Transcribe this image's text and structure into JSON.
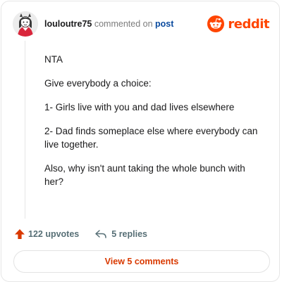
{
  "comment": {
    "username": "louloutre75",
    "commented_text": "commented on",
    "post_link": "post",
    "body": [
      "NTA",
      "Give everybody a choice:",
      "1- Girls live with you and dad lives elsewhere",
      "2- Dad finds someplace else where everybody can live together.",
      "Also, why isn't aunt taking the whole bunch with her?"
    ],
    "upvotes": "122 upvotes",
    "replies": "5 replies",
    "view_comments": "View 5 comments"
  },
  "brand": {
    "name": "reddit",
    "icon": "reddit-logo-icon",
    "color": "#ff4500"
  },
  "icons": {
    "upvote": "upvote-arrow-icon",
    "reply": "reply-arrow-icon",
    "avatar": "user-avatar-icon"
  }
}
